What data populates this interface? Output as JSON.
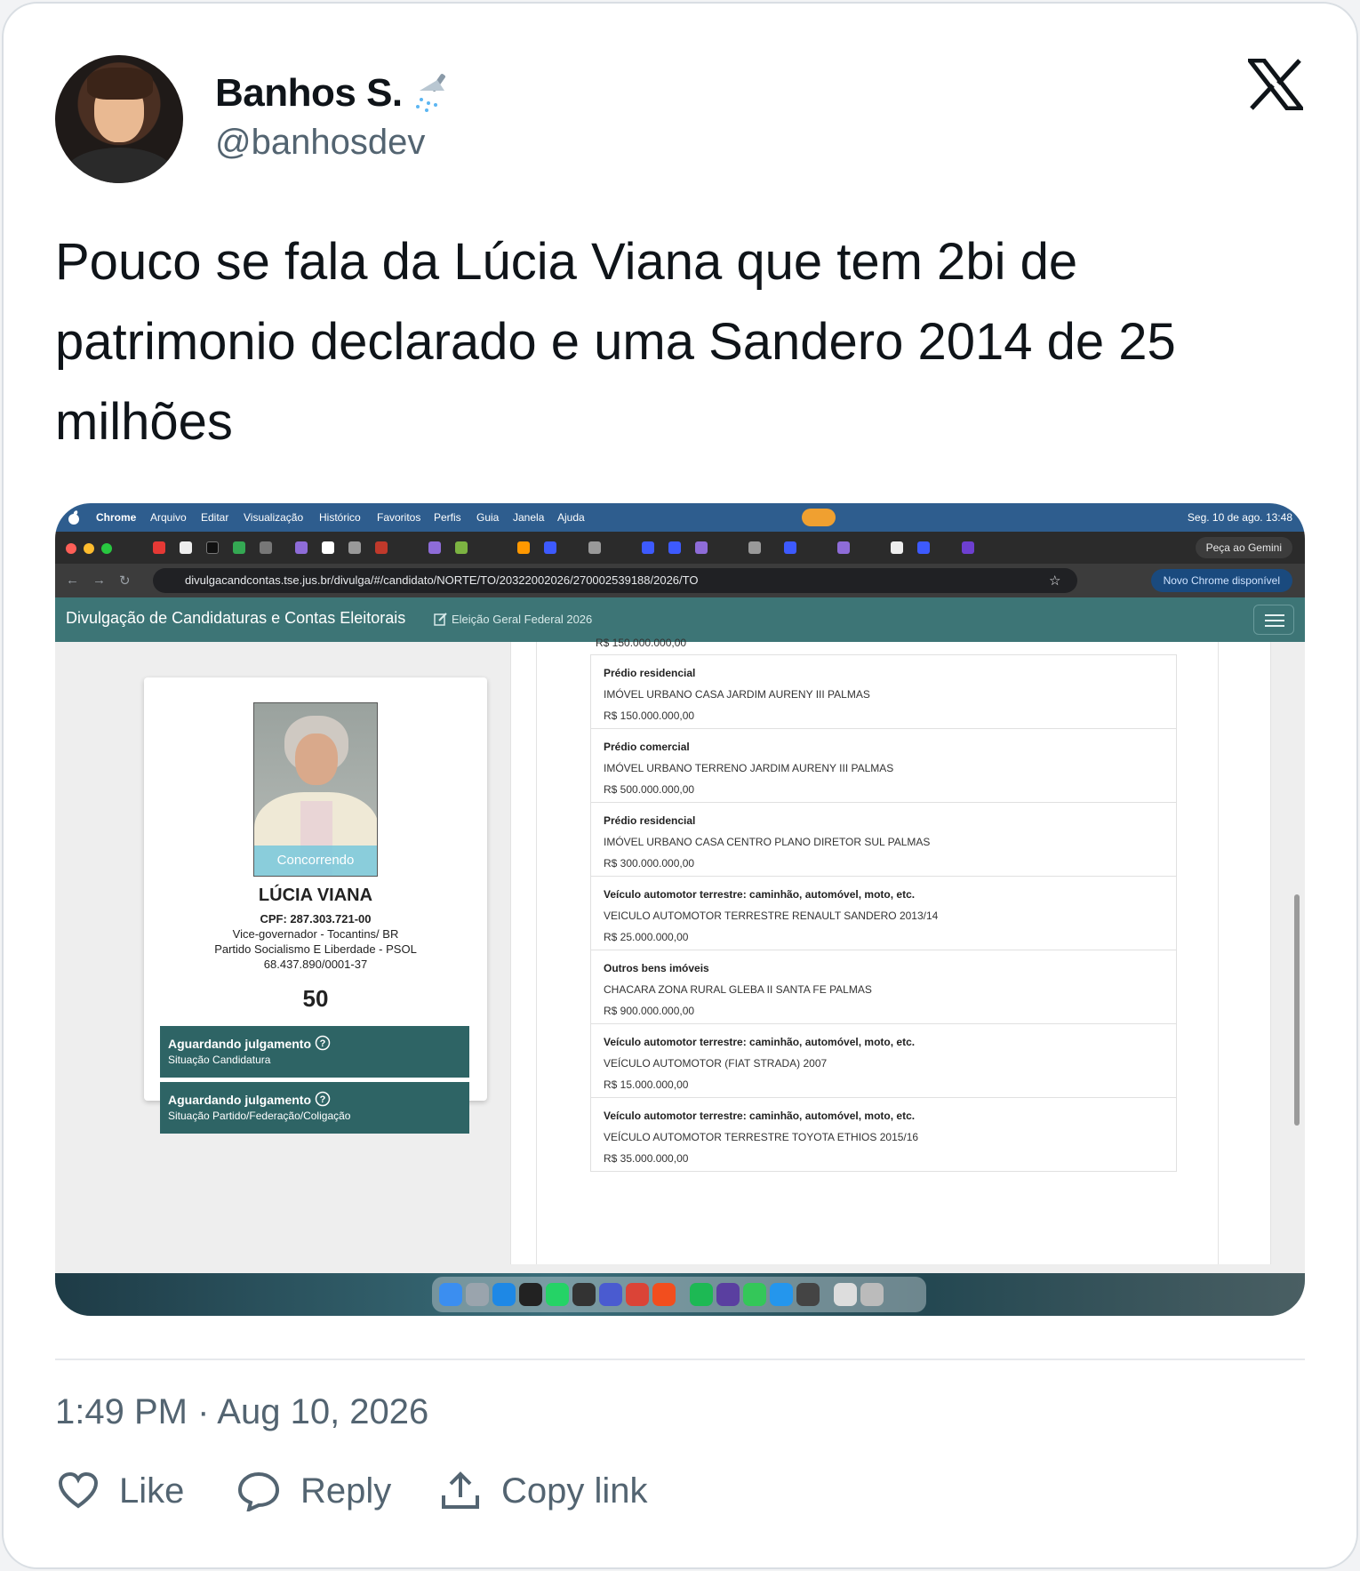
{
  "tweet": {
    "author_name": "Banhos S.",
    "author_handle": "@banhosdev",
    "emoji_icon": "shower-icon",
    "brand_icon": "x-logo-icon",
    "text": "Pouco se fala da Lúcia Viana que tem 2bi de patrimonio declarado e uma Sandero 2014 de 25 milhões",
    "timestamp": "1:49 PM · Aug 10, 2026",
    "actions": {
      "like": "Like",
      "reply": "Reply",
      "copy_link": "Copy link"
    }
  },
  "screenshot": {
    "mac_menu": {
      "items": [
        "Chrome",
        "Arquivo",
        "Editar",
        "Visualização",
        "Histórico",
        "Favoritos",
        "Perfis",
        "Guia",
        "Janela",
        "Ajuda"
      ],
      "clock": "Seg. 10 de ago. 13:48"
    },
    "browser": {
      "gemini_button": "Peça ao Gemini",
      "url": "divulgacandcontas.tse.jus.br/divulga/#/candidato/NORTE/TO/20322002026/270002539188/2026/TO",
      "update_button": "Novo Chrome disponível"
    },
    "site": {
      "title": "Divulgação de Candidaturas e Contas Eleitorais",
      "subtitle": "Eleição Geral Federal 2026"
    },
    "candidate": {
      "badge": "Concorrendo",
      "name": "LÚCIA VIANA",
      "cpf": "CPF: 287.303.721-00",
      "office": "Vice-governador - Tocantins/ BR",
      "party": "Partido Socialismo E Liberdade - PSOL",
      "cnpj": "68.437.890/0001-37",
      "number": "50",
      "status": [
        {
          "title": "Aguardando julgamento",
          "subtitle": "Situação Candidatura"
        },
        {
          "title": "Aguardando julgamento",
          "subtitle": "Situação Partido/Federação/Coligação"
        }
      ]
    },
    "assets_cut_top": "R$ 150.000.000,00",
    "assets": [
      {
        "type": "Prédio residencial",
        "description": "IMÓVEL URBANO CASA JARDIM AURENY III PALMAS",
        "value": "R$ 150.000.000,00"
      },
      {
        "type": "Prédio comercial",
        "description": "IMÓVEL URBANO TERRENO JARDIM AURENY III PALMAS",
        "value": "R$ 500.000.000,00"
      },
      {
        "type": "Prédio residencial",
        "description": "IMÓVEL URBANO CASA CENTRO PLANO DIRETOR SUL PALMAS",
        "value": "R$ 300.000.000,00"
      },
      {
        "type": "Veículo automotor terrestre: caminhão, automóvel, moto, etc.",
        "description": "VEICULO AUTOMOTOR TERRESTRE RENAULT SANDERO 2013/14",
        "value": "R$ 25.000.000,00"
      },
      {
        "type": "Outros bens imóveis",
        "description": "CHACARA ZONA RURAL GLEBA II SANTA FE PALMAS",
        "value": "R$ 900.000.000,00"
      },
      {
        "type": "Veículo automotor terrestre: caminhão, automóvel, moto, etc.",
        "description": "VEÍCULO AUTOMOTOR (FIAT STRADA) 2007",
        "value": "R$ 15.000.000,00"
      },
      {
        "type": "Veículo automotor terrestre: caminhão, automóvel, moto, etc.",
        "description": "VEÍCULO AUTOMOTOR TERRESTRE TOYOTA ETHIOS 2015/16",
        "value": "R$ 35.000.000,00"
      }
    ]
  }
}
